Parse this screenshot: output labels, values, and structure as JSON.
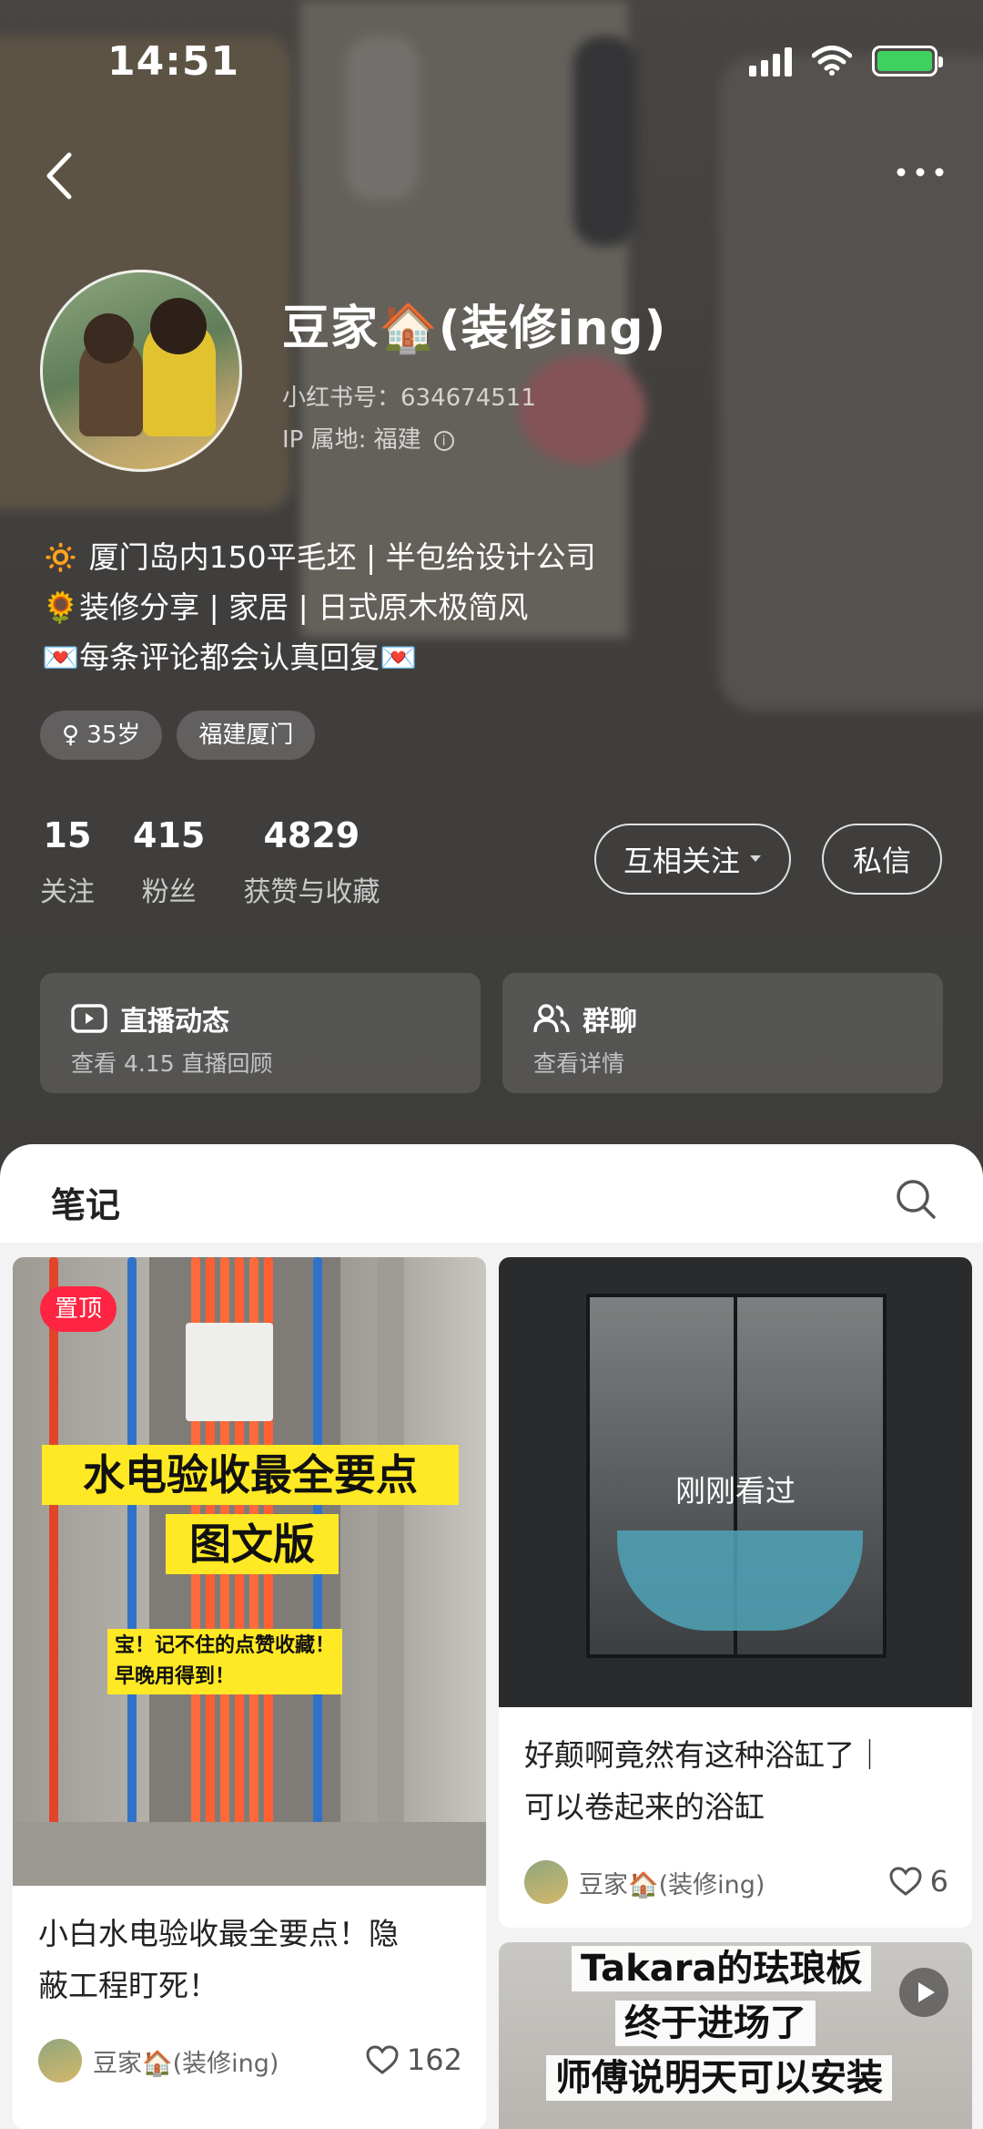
{
  "status_bar": {
    "time": "14:51"
  },
  "profile": {
    "name": "豆家🏠(装修ing)",
    "id_line": "小红书号：634674511",
    "ip_line": "IP 属地: 福建",
    "bio": [
      "🔅 厦门岛内150平毛坯 | 半包给设计公司",
      "🌻装修分享 | 家居 | 日式原木极简风",
      "💌每条评论都会认真回复💌"
    ],
    "tags": [
      "♀ 35岁",
      "福建厦门"
    ],
    "stats": [
      {
        "value": "15",
        "label": "关注"
      },
      {
        "value": "415",
        "label": "粉丝"
      },
      {
        "value": "4829",
        "label": "获赞与收藏"
      }
    ],
    "follow_label": "互相关注",
    "message_label": "私信",
    "cards": [
      {
        "title": "直播动态",
        "subtitle": "查看 4.15 直播回顾",
        "icon": "live-icon"
      },
      {
        "title": "群聊",
        "subtitle": "查看详情",
        "icon": "group-icon"
      }
    ]
  },
  "notes_panel": {
    "title": "笔记"
  },
  "notes": [
    {
      "badge": "置顶",
      "image_text_main_1": "水电验收最全要点",
      "image_text_main_2": "图文版",
      "image_text_sub_1": "宝！记不住的点赞收藏！",
      "image_text_sub_2": "早晚用得到！",
      "title_line_1": "小白水电验收最全要点！隐",
      "title_line_2": "蔽工程盯死！",
      "author": "豆家🏠(装修ing)",
      "likes": "162"
    },
    {
      "overlay": "刚刚看过",
      "title_line_1": "好颠啊竟然有这种浴缸了｜",
      "title_line_2": "可以卷起来的浴缸",
      "author": "豆家🏠(装修ing)",
      "likes": "6"
    },
    {
      "image_text_1": "Takara的珐琅板",
      "image_text_2": "终于进场了",
      "image_text_3": "师傅说明天可以安装"
    }
  ],
  "colors": {
    "accent_red": "#ff2442",
    "highlight_yellow": "#ffe924"
  }
}
